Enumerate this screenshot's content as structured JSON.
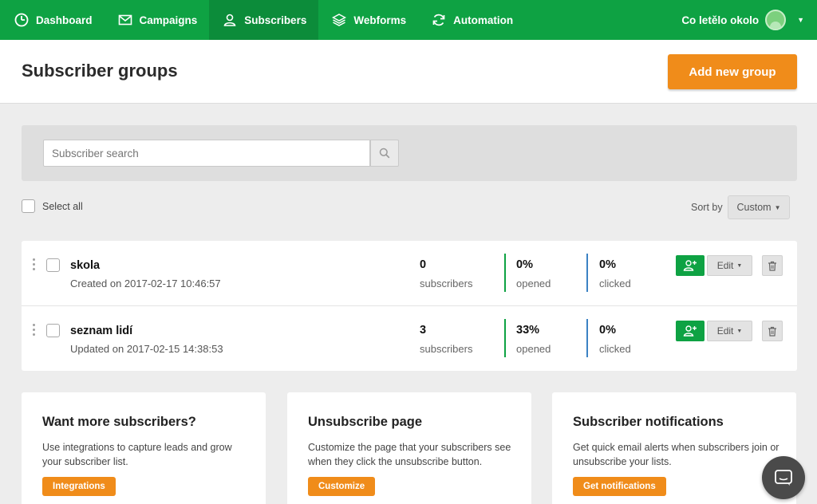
{
  "nav": {
    "items": [
      {
        "label": "Dashboard",
        "icon": "clock-icon"
      },
      {
        "label": "Campaigns",
        "icon": "envelope-icon"
      },
      {
        "label": "Subscribers",
        "icon": "user-icon",
        "active": true
      },
      {
        "label": "Webforms",
        "icon": "layers-icon"
      },
      {
        "label": "Automation",
        "icon": "refresh-icon"
      }
    ],
    "user_name": "Co letělo okolo"
  },
  "header": {
    "title": "Subscriber groups",
    "add_button": "Add new group"
  },
  "search": {
    "placeholder": "Subscriber search"
  },
  "toolbar": {
    "select_all": "Select all",
    "sort_label": "Sort by",
    "sort_value": "Custom"
  },
  "groups": [
    {
      "name": "skola",
      "date": "Created on 2017-02-17 10:46:57",
      "subscribers": "0",
      "subscribers_label": "subscribers",
      "opened": "0%",
      "opened_label": "opened",
      "clicked": "0%",
      "clicked_label": "clicked",
      "edit_label": "Edit"
    },
    {
      "name": "seznam lidí",
      "date": "Updated on 2017-02-15 14:38:53",
      "subscribers": "3",
      "subscribers_label": "subscribers",
      "opened": "33%",
      "opened_label": "opened",
      "clicked": "0%",
      "clicked_label": "clicked",
      "edit_label": "Edit"
    }
  ],
  "cards": [
    {
      "title": "Want more subscribers?",
      "text": "Use integrations to capture leads and grow your subscriber list.",
      "button": "Integrations"
    },
    {
      "title": "Unsubscribe page",
      "text": "Customize the page that your subscribers see when they click the unsubscribe button.",
      "button": "Customize"
    },
    {
      "title": "Subscriber notifications",
      "text": "Get quick email alerts when subscribers join or unsubscribe your lists.",
      "button": "Get notifications"
    }
  ],
  "colors": {
    "brand_green": "#0ea243",
    "accent_orange": "#f08c1a",
    "clicked_blue": "#3b82c4"
  }
}
